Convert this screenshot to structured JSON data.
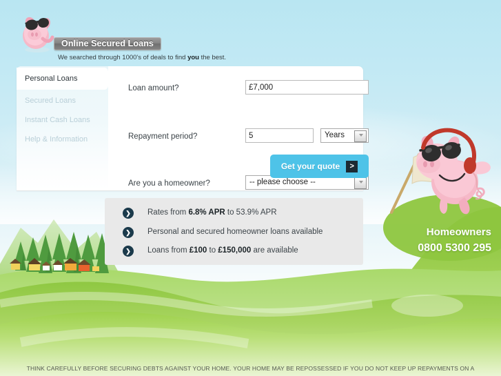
{
  "brand": {
    "logo_text": "Online Secured Loans",
    "tagline_pre": "We searched through 1000's of deals to find ",
    "tagline_bold": "you",
    "tagline_post": " the best.",
    "mascot_icon": "pig-mascot-icon",
    "hero_mascot_icon": "pig-with-sunglasses-flag-icon"
  },
  "colors": {
    "sky": "#c2e9f4",
    "accent_button": "#4ec3e8",
    "bullet_dot": "#1b3a4b",
    "panel": "#ffffff",
    "bullets_box": "#e9e9e9",
    "hill_green": "#8ec63f"
  },
  "nav": {
    "items": [
      {
        "label": "Personal Loans",
        "active": true
      },
      {
        "label": "Secured Loans",
        "active": false
      },
      {
        "label": "Instant Cash Loans",
        "active": false
      },
      {
        "label": "Help & Information",
        "active": false
      }
    ]
  },
  "form": {
    "fields": [
      {
        "label": "Loan amount?",
        "value": "£7,000"
      },
      {
        "label": "Repayment period?",
        "value": "5",
        "unit": "Years"
      },
      {
        "label": "Are you a homeowner?",
        "value": "-- please choose --"
      }
    ],
    "submit_label": "Get your quote",
    "submit_chevron": ">"
  },
  "bullets": {
    "icon": "chevron-circle-icon",
    "items": [
      {
        "pre": "Rates from ",
        "bold": "6.8% APR",
        "post": " to 53.9% APR"
      },
      {
        "pre": "Personal and secured homeowner loans available",
        "bold": "",
        "post": ""
      },
      {
        "pre": "Loans from ",
        "bold": "£100",
        "mid": " to ",
        "bold2": "£150,000",
        "post": " are available"
      }
    ]
  },
  "phone": {
    "title": "Homeowners",
    "number": "0800 5300 295"
  },
  "footer": {
    "disclaimer": "THINK CAREFULLY BEFORE SECURING DEBTS AGAINST YOUR HOME. YOUR HOME MAY BE REPOSSESSED IF YOU DO NOT KEEP UP REPAYMENTS ON A"
  }
}
